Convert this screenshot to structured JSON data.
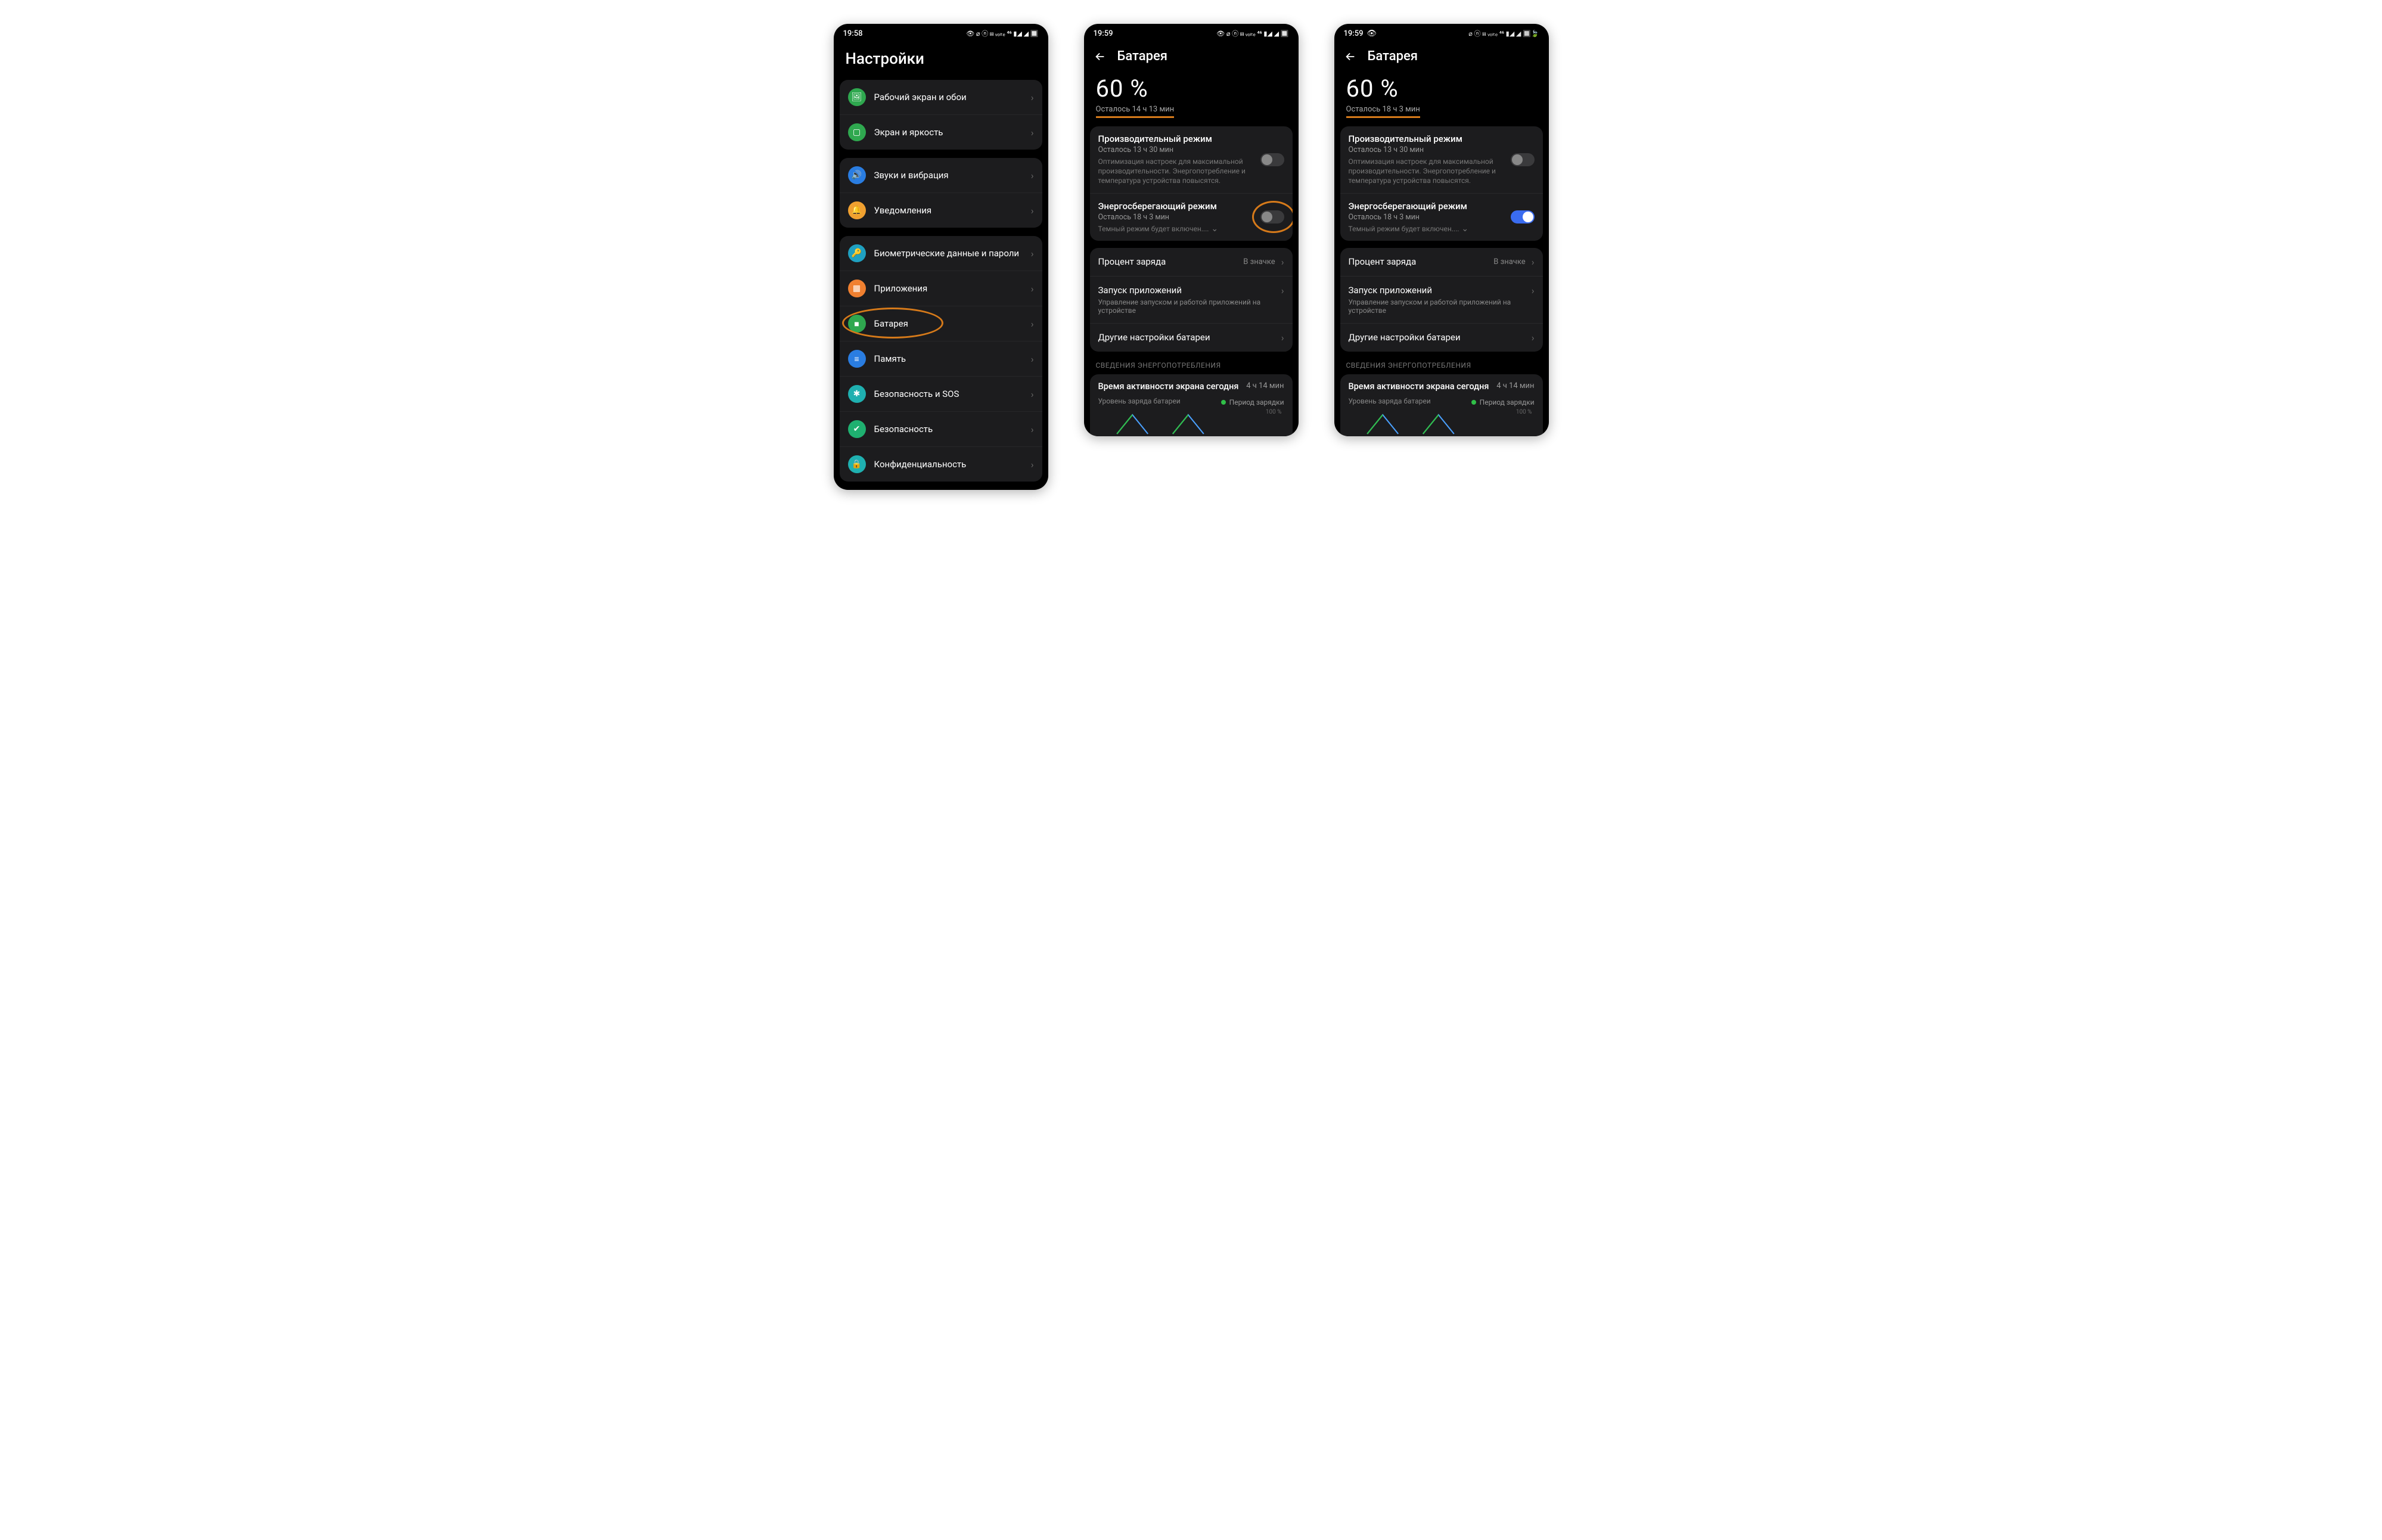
{
  "screen1": {
    "status": {
      "time": "19:58",
      "icons": "👁 ⌀ ⓝ ⩎ ᵥₒₗₜₑ ⁴⁶ ▮◢ ◢ 🔲"
    },
    "title": "Настройки",
    "groups": [
      {
        "items": [
          {
            "icon": "🖼",
            "color": "#2fa84f",
            "label": "Рабочий экран и обои"
          },
          {
            "icon": "▢",
            "color": "#2fa84f",
            "label": "Экран и яркость"
          }
        ]
      },
      {
        "items": [
          {
            "icon": "🔊",
            "color": "#2a7de1",
            "label": "Звуки и вибрация"
          },
          {
            "icon": "🔔",
            "color": "#f0a030",
            "label": "Уведомления"
          }
        ]
      },
      {
        "items": [
          {
            "icon": "🔑",
            "color": "#1fa0c0",
            "label": "Биометрические данные и пароли"
          },
          {
            "icon": "▦",
            "color": "#f08030",
            "label": "Приложения"
          },
          {
            "icon": "■",
            "color": "#2fa84f",
            "label": "Батарея",
            "highlight": true
          },
          {
            "icon": "≡",
            "color": "#2a7de1",
            "label": "Память"
          },
          {
            "icon": "✱",
            "color": "#1fb0b0",
            "label": "Безопасность и SOS"
          },
          {
            "icon": "✔",
            "color": "#1fb070",
            "label": "Безопасность"
          },
          {
            "icon": "🔒",
            "color": "#1fb0b0",
            "label": "Конфиденциальность"
          }
        ]
      }
    ]
  },
  "screen2": {
    "status": {
      "time": "19:59",
      "icons": "👁 ⌀ ⓝ ⩎ ᵥₒₗₜₑ ⁴⁶ ▮◢ ◢ 🔲"
    },
    "title": "Батарея",
    "pct": "60 %",
    "remain": "Осталось 14 ч 13 мин",
    "perf": {
      "title": "Производительный режим",
      "sub": "Осталось 13 ч 30 мин",
      "desc": "Оптимизация настроек для максимальной производительности. Энергопотребление и температура устройства повысятся.",
      "on": false
    },
    "eco": {
      "title": "Энергосберегающий режим",
      "sub": "Осталось 18 ч 3 мин",
      "desc": "Темный режим будет включен....",
      "on": false,
      "highlight": true
    },
    "rows": {
      "charge_label": "Процент заряда",
      "charge_value": "В значке",
      "launch_title": "Запуск приложений",
      "launch_sub": "Управление запуском и работой приложений на устройстве",
      "other": "Другие настройки батареи"
    },
    "usage": {
      "section": "СВЕДЕНИЯ ЭНЕРГОПОТРЕБЛЕНИЯ",
      "title": "Время активности экрана сегодня",
      "val": "4 ч 14 мин",
      "legend_left": "Уровень заряда батареи",
      "legend_right": "Период зарядки",
      "y100": "100 %"
    }
  },
  "screen3": {
    "status": {
      "time": "19:59",
      "eye": "👁",
      "icons": "⌀ ⓝ ⩎ ᵥₒₗₜₑ ⁴⁶ ▮◢ ◢ 🔲🍃"
    },
    "title": "Батарея",
    "pct": "60 %",
    "remain": "Осталось 18 ч 3 мин",
    "perf": {
      "title": "Производительный режим",
      "sub": "Осталось 13 ч 30 мин",
      "desc": "Оптимизация настроек для максимальной производительности. Энергопотребление и температура устройства повысятся.",
      "on": false
    },
    "eco": {
      "title": "Энергосберегающий режим",
      "sub": "Осталось 18 ч 3 мин",
      "desc": "Темный режим будет включен....",
      "on": true
    },
    "rows": {
      "charge_label": "Процент заряда",
      "charge_value": "В значке",
      "launch_title": "Запуск приложений",
      "launch_sub": "Управление запуском и работой приложений на устройстве",
      "other": "Другие настройки батареи"
    },
    "usage": {
      "section": "СВЕДЕНИЯ ЭНЕРГОПОТРЕБЛЕНИЯ",
      "title": "Время активности экрана сегодня",
      "val": "4 ч 14 мин",
      "legend_left": "Уровень заряда батареи",
      "legend_right": "Период зарядки",
      "y100": "100 %"
    }
  }
}
